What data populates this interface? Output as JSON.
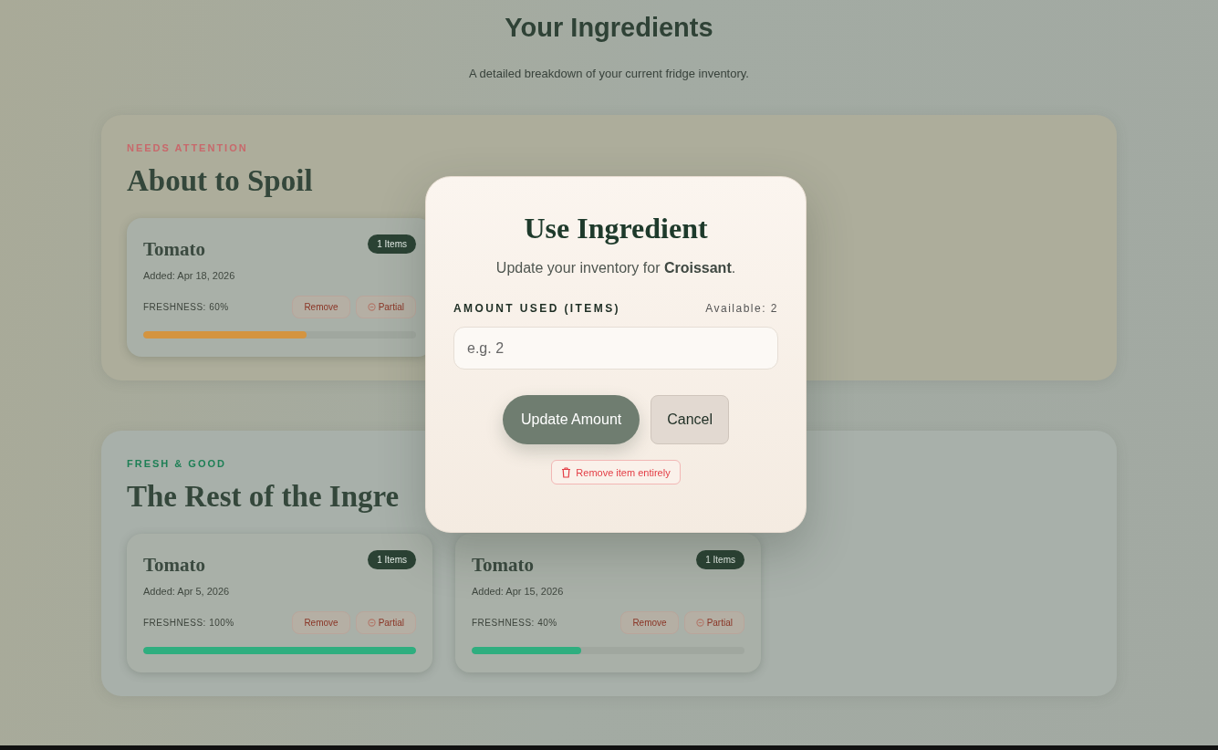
{
  "page": {
    "title": "Your Ingredients",
    "subtitle": "A detailed breakdown of your current fridge inventory.",
    "sections": [
      {
        "eyebrow": "NEEDS ATTENTION",
        "color": "#c8686b",
        "title": "About to Spoil",
        "tinted": true,
        "items": [
          {
            "name": "Tomato",
            "added": "Added: Apr 18, 2026",
            "badge": "1 Items",
            "freshness": "FRESHNESS: 60%",
            "level": 0.6,
            "color": "#d49440",
            "actions": [
              {
                "kind": "remove",
                "label": "Remove"
              },
              {
                "kind": "partial",
                "label": "Partial"
              }
            ]
          }
        ]
      },
      {
        "eyebrow": "FRESH & GOOD",
        "color": "#1d7f55",
        "title": "The Rest of the Ingre",
        "tinted": false,
        "items": [
          {
            "name": "Tomato",
            "added": "Added: Apr 5, 2026",
            "badge": "1 Items",
            "freshness": "FRESHNESS: 100%",
            "level": 1,
            "color": "#2fae7f",
            "actions": [
              {
                "kind": "remove",
                "label": "Remove"
              },
              {
                "kind": "partial",
                "label": "Partial"
              }
            ]
          },
          {
            "name": "Tomato",
            "added": "Added: Apr 15, 2026",
            "badge": "1 Items",
            "freshness": "FRESHNESS: 40%",
            "level": 0.4,
            "color": "#2fae7f",
            "actions": [
              {
                "kind": "remove",
                "label": "Remove"
              },
              {
                "kind": "partial",
                "label": "Partial"
              }
            ]
          }
        ]
      }
    ]
  },
  "dialog": {
    "title": "Use Ingredient",
    "message": "Update your inventory for **Croissant**.",
    "field_label": "AMOUNT USED (ITEMS)",
    "available": "Available: 2",
    "placeholder": "e.g. 2",
    "primary": "Update Amount",
    "secondary": "Cancel",
    "danger": "Remove item entirely"
  }
}
